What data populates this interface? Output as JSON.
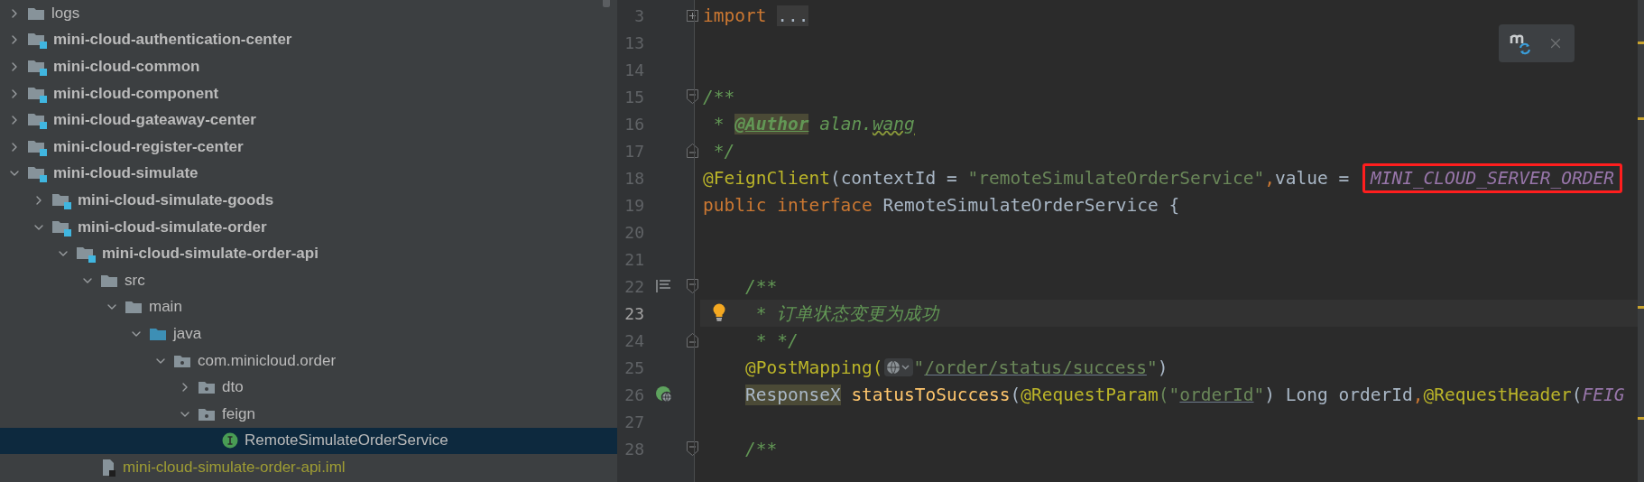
{
  "project_tree": {
    "items": [
      {
        "label": "logs",
        "kind": "folder",
        "expanded": false,
        "selected": false
      },
      {
        "label": "mini-cloud-authentication-center",
        "kind": "module",
        "expanded": false,
        "selected": false
      },
      {
        "label": "mini-cloud-common",
        "kind": "module",
        "expanded": false,
        "selected": false
      },
      {
        "label": "mini-cloud-component",
        "kind": "module",
        "expanded": false,
        "selected": false
      },
      {
        "label": "mini-cloud-gateaway-center",
        "kind": "module",
        "expanded": false,
        "selected": false
      },
      {
        "label": "mini-cloud-register-center",
        "kind": "module",
        "expanded": false,
        "selected": false
      },
      {
        "label": "mini-cloud-simulate",
        "kind": "module",
        "expanded": true,
        "selected": false,
        "children": [
          {
            "label": "mini-cloud-simulate-goods",
            "kind": "module",
            "expanded": false,
            "selected": false
          },
          {
            "label": "mini-cloud-simulate-order",
            "kind": "module",
            "expanded": true,
            "selected": false,
            "children": [
              {
                "label": "mini-cloud-simulate-order-api",
                "kind": "module",
                "expanded": true,
                "selected": false,
                "children": [
                  {
                    "label": "src",
                    "kind": "folder",
                    "expanded": true,
                    "selected": false,
                    "children": [
                      {
                        "label": "main",
                        "kind": "folder",
                        "expanded": true,
                        "selected": false,
                        "children": [
                          {
                            "label": "java",
                            "kind": "source-root",
                            "expanded": true,
                            "selected": false,
                            "children": [
                              {
                                "label": "com.minicloud.order",
                                "kind": "package",
                                "expanded": true,
                                "selected": false,
                                "children": [
                                  {
                                    "label": "dto",
                                    "kind": "package",
                                    "expanded": false,
                                    "selected": false
                                  },
                                  {
                                    "label": "feign",
                                    "kind": "package",
                                    "expanded": true,
                                    "selected": false,
                                    "children": [
                                      {
                                        "label": "RemoteSimulateOrderService",
                                        "kind": "interface",
                                        "selected": true
                                      }
                                    ]
                                  }
                                ]
                              }
                            ]
                          }
                        ]
                      }
                    ]
                  },
                  {
                    "label": "mini-cloud-simulate-order-api.iml",
                    "kind": "module-file",
                    "selected": false
                  }
                ]
              }
            ]
          }
        ]
      }
    ]
  },
  "editor": {
    "lines": [
      {
        "number": "3",
        "fold": {
          "kind": "expand"
        },
        "tokens": [
          {
            "t": "import ",
            "kind": "keyword"
          },
          {
            "t": "...",
            "kind": "folded"
          }
        ]
      },
      {
        "number": "13"
      },
      {
        "number": "14"
      },
      {
        "number": "15",
        "fold": {
          "kind": "start"
        },
        "tokens": [
          {
            "t": "/**",
            "kind": "comment"
          }
        ]
      },
      {
        "number": "16",
        "tokens": [
          {
            "t": " * ",
            "kind": "comment"
          },
          {
            "t": "@Author",
            "kind": "doctag"
          },
          {
            "t": " alan.",
            "kind": "comment"
          },
          {
            "t": "wang",
            "kind": "typo"
          }
        ]
      },
      {
        "number": "17",
        "fold": {
          "kind": "end"
        },
        "tokens": [
          {
            "t": " */",
            "kind": "comment"
          }
        ]
      },
      {
        "number": "18",
        "tokens": [
          {
            "t": "@FeignClient",
            "kind": "annotation"
          },
          {
            "t": "(contextId = ",
            "kind": "plain"
          },
          {
            "t": "\"remoteSimulateOrderService\"",
            "kind": "string"
          },
          {
            "t": ",",
            "kind": "keyword"
          },
          {
            "t": "value = ",
            "kind": "plain"
          },
          {
            "t": "MINI_CLOUD_SERVER_ORDER",
            "kind": "constant",
            "boxed": true
          }
        ]
      },
      {
        "number": "19",
        "tokens": [
          {
            "t": "public interface ",
            "kind": "keyword"
          },
          {
            "t": "RemoteSimulateOrderService {",
            "kind": "plain"
          }
        ]
      },
      {
        "number": "20"
      },
      {
        "number": "21"
      },
      {
        "number": "22",
        "gutter": {
          "kind": "structure"
        },
        "fold": {
          "kind": "start"
        },
        "tokens": [
          {
            "t": "    /**",
            "kind": "comment"
          }
        ]
      },
      {
        "number": "23",
        "current": true,
        "bulb": true,
        "tokens": [
          {
            "t": "     * 订单状态变更为成功",
            "kind": "comment"
          }
        ]
      },
      {
        "number": "24",
        "fold": {
          "kind": "end"
        },
        "tokens": [
          {
            "t": "     * */",
            "kind": "comment"
          }
        ]
      },
      {
        "number": "25",
        "tokens": [
          {
            "t": "    @PostMapping(",
            "kind": "annotation"
          },
          {
            "kind": "inlay"
          },
          {
            "t": "\"",
            "kind": "string"
          },
          {
            "t": "/order/status/success",
            "kind": "link"
          },
          {
            "t": "\"",
            "kind": "string"
          },
          {
            "t": ")",
            "kind": "plain"
          }
        ]
      },
      {
        "number": "26",
        "gutter": {
          "kind": "web"
        },
        "tokens": [
          {
            "t": "    ResponseX",
            "kind": "marked"
          },
          {
            "t": " statusToSuccess",
            "kind": "method"
          },
          {
            "t": "(",
            "kind": "plain"
          },
          {
            "t": "@RequestParam",
            "kind": "annotation"
          },
          {
            "t": "(\"",
            "kind": "string"
          },
          {
            "t": "orderId",
            "kind": "link"
          },
          {
            "t": "\"",
            "kind": "string"
          },
          {
            "t": ") Long orderId",
            "kind": "plain"
          },
          {
            "t": ",",
            "kind": "keyword"
          },
          {
            "t": "@RequestHeader",
            "kind": "annotation"
          },
          {
            "t": "(",
            "kind": "plain"
          },
          {
            "t": "FEIG",
            "kind": "constant"
          }
        ]
      },
      {
        "number": "27"
      },
      {
        "number": "28",
        "fold": {
          "kind": "start"
        },
        "tokens": [
          {
            "t": "    /**",
            "kind": "comment"
          }
        ]
      }
    ],
    "stripe_marks": [
      {
        "kind": "warning"
      },
      {
        "kind": "warning"
      },
      {
        "kind": "warning"
      },
      {
        "kind": "warning"
      }
    ]
  }
}
